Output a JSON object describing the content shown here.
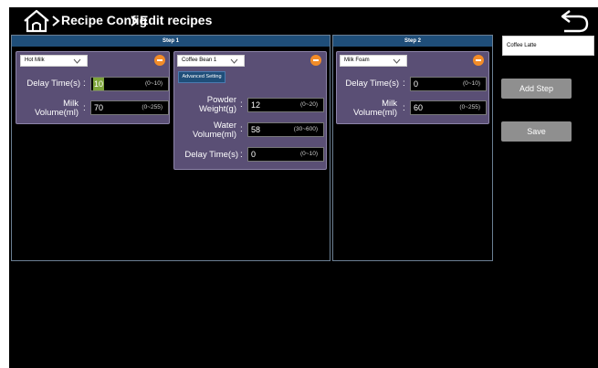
{
  "header": {
    "breadcrumb": [
      "Recipe Config",
      "Edit recipes"
    ],
    "home_icon": "home-icon",
    "back_icon": "back-arrow-icon"
  },
  "steps": [
    {
      "title": "Step 1",
      "cards": [
        {
          "select": "Hot Milk",
          "fields": [
            {
              "label": "Delay Time(s)",
              "value": "10",
              "range": "(0~10)"
            },
            {
              "label": "Milk Volume(ml)",
              "value": "70",
              "range": "(0~255)"
            }
          ]
        },
        {
          "select": "Coffee Bean 1",
          "advanced": "Advanced Setting",
          "fields": [
            {
              "label": "Powder Weight(g)",
              "value": "12",
              "range": "(0~20)"
            },
            {
              "label": "Water Volume(ml)",
              "value": "58",
              "range": "(30~600)"
            },
            {
              "label": "Delay Time(s)",
              "value": "0",
              "range": "(0~10)"
            }
          ]
        }
      ]
    },
    {
      "title": "Step 2",
      "cards": [
        {
          "select": "Milk Foam",
          "fields": [
            {
              "label": "Delay Time(s)",
              "value": "0",
              "range": "(0~10)"
            },
            {
              "label": "Milk Volume(ml)",
              "value": "60",
              "range": "(0~255)"
            }
          ]
        }
      ]
    }
  ],
  "sidebar": {
    "recipe_name": "Coffee Latte",
    "add_step": "Add Step",
    "save": "Save"
  },
  "colors": {
    "step_header": "#1f4e79",
    "card_bg": "#5a4f75",
    "remove_button": "#f28c28",
    "highlight": "#7da33a"
  }
}
